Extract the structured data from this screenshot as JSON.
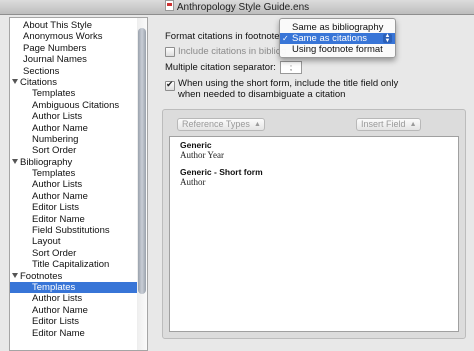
{
  "window": {
    "title": "Anthropology Style Guide.ens"
  },
  "sidebar": {
    "items": [
      {
        "label": "About This Style",
        "kind": "top"
      },
      {
        "label": "Anonymous Works",
        "kind": "top"
      },
      {
        "label": "Page Numbers",
        "kind": "top"
      },
      {
        "label": "Journal Names",
        "kind": "top"
      },
      {
        "label": "Sections",
        "kind": "top"
      },
      {
        "label": "Citations",
        "kind": "group"
      },
      {
        "label": "Templates",
        "kind": "sub"
      },
      {
        "label": "Ambiguous Citations",
        "kind": "sub"
      },
      {
        "label": "Author Lists",
        "kind": "sub"
      },
      {
        "label": "Author Name",
        "kind": "sub"
      },
      {
        "label": "Numbering",
        "kind": "sub"
      },
      {
        "label": "Sort Order",
        "kind": "sub"
      },
      {
        "label": "Bibliography",
        "kind": "group"
      },
      {
        "label": "Templates",
        "kind": "sub"
      },
      {
        "label": "Author Lists",
        "kind": "sub"
      },
      {
        "label": "Author Name",
        "kind": "sub"
      },
      {
        "label": "Editor Lists",
        "kind": "sub"
      },
      {
        "label": "Editor Name",
        "kind": "sub"
      },
      {
        "label": "Field Substitutions",
        "kind": "sub"
      },
      {
        "label": "Layout",
        "kind": "sub"
      },
      {
        "label": "Sort Order",
        "kind": "sub"
      },
      {
        "label": "Title Capitalization",
        "kind": "sub"
      },
      {
        "label": "Footnotes",
        "kind": "group"
      },
      {
        "label": "Templates",
        "kind": "sub",
        "selected": true
      },
      {
        "label": "Author Lists",
        "kind": "sub"
      },
      {
        "label": "Author Name",
        "kind": "sub"
      },
      {
        "label": "Editor Lists",
        "kind": "sub"
      },
      {
        "label": "Editor Name",
        "kind": "sub"
      }
    ]
  },
  "footnotes_panel": {
    "format_label": "Format citations in footnotes:",
    "include_label": "Include citations in bibliog",
    "separator_label": "Multiple citation separator:",
    "separator_value": ";",
    "short_form_label_1": "When using the short form, include the title field only",
    "short_form_label_2": "when needed to disambiguate a citation",
    "short_form_checked": true,
    "reference_types_label": "Reference Types",
    "insert_field_label": "Insert Field",
    "preview": [
      {
        "title": "Generic",
        "value": "Author Year"
      },
      {
        "title": "Generic - Short form",
        "value": "Author"
      }
    ]
  },
  "format_menu": {
    "options": [
      "Same as bibliography",
      "Same as citations",
      "Using footnote format"
    ],
    "selected": "Same as citations",
    "check_glyph": "✓"
  },
  "colors": {
    "selection": "#3875d7"
  }
}
